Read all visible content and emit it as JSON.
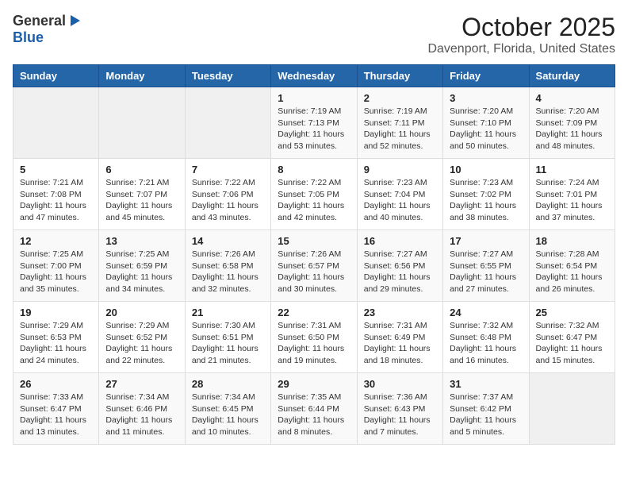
{
  "logo": {
    "general": "General",
    "blue": "Blue"
  },
  "header": {
    "month": "October 2025",
    "location": "Davenport, Florida, United States"
  },
  "weekdays": [
    "Sunday",
    "Monday",
    "Tuesday",
    "Wednesday",
    "Thursday",
    "Friday",
    "Saturday"
  ],
  "weeks": [
    [
      {
        "day": "",
        "info": ""
      },
      {
        "day": "",
        "info": ""
      },
      {
        "day": "",
        "info": ""
      },
      {
        "day": "1",
        "info": "Sunrise: 7:19 AM\nSunset: 7:13 PM\nDaylight: 11 hours\nand 53 minutes."
      },
      {
        "day": "2",
        "info": "Sunrise: 7:19 AM\nSunset: 7:11 PM\nDaylight: 11 hours\nand 52 minutes."
      },
      {
        "day": "3",
        "info": "Sunrise: 7:20 AM\nSunset: 7:10 PM\nDaylight: 11 hours\nand 50 minutes."
      },
      {
        "day": "4",
        "info": "Sunrise: 7:20 AM\nSunset: 7:09 PM\nDaylight: 11 hours\nand 48 minutes."
      }
    ],
    [
      {
        "day": "5",
        "info": "Sunrise: 7:21 AM\nSunset: 7:08 PM\nDaylight: 11 hours\nand 47 minutes."
      },
      {
        "day": "6",
        "info": "Sunrise: 7:21 AM\nSunset: 7:07 PM\nDaylight: 11 hours\nand 45 minutes."
      },
      {
        "day": "7",
        "info": "Sunrise: 7:22 AM\nSunset: 7:06 PM\nDaylight: 11 hours\nand 43 minutes."
      },
      {
        "day": "8",
        "info": "Sunrise: 7:22 AM\nSunset: 7:05 PM\nDaylight: 11 hours\nand 42 minutes."
      },
      {
        "day": "9",
        "info": "Sunrise: 7:23 AM\nSunset: 7:04 PM\nDaylight: 11 hours\nand 40 minutes."
      },
      {
        "day": "10",
        "info": "Sunrise: 7:23 AM\nSunset: 7:02 PM\nDaylight: 11 hours\nand 38 minutes."
      },
      {
        "day": "11",
        "info": "Sunrise: 7:24 AM\nSunset: 7:01 PM\nDaylight: 11 hours\nand 37 minutes."
      }
    ],
    [
      {
        "day": "12",
        "info": "Sunrise: 7:25 AM\nSunset: 7:00 PM\nDaylight: 11 hours\nand 35 minutes."
      },
      {
        "day": "13",
        "info": "Sunrise: 7:25 AM\nSunset: 6:59 PM\nDaylight: 11 hours\nand 34 minutes."
      },
      {
        "day": "14",
        "info": "Sunrise: 7:26 AM\nSunset: 6:58 PM\nDaylight: 11 hours\nand 32 minutes."
      },
      {
        "day": "15",
        "info": "Sunrise: 7:26 AM\nSunset: 6:57 PM\nDaylight: 11 hours\nand 30 minutes."
      },
      {
        "day": "16",
        "info": "Sunrise: 7:27 AM\nSunset: 6:56 PM\nDaylight: 11 hours\nand 29 minutes."
      },
      {
        "day": "17",
        "info": "Sunrise: 7:27 AM\nSunset: 6:55 PM\nDaylight: 11 hours\nand 27 minutes."
      },
      {
        "day": "18",
        "info": "Sunrise: 7:28 AM\nSunset: 6:54 PM\nDaylight: 11 hours\nand 26 minutes."
      }
    ],
    [
      {
        "day": "19",
        "info": "Sunrise: 7:29 AM\nSunset: 6:53 PM\nDaylight: 11 hours\nand 24 minutes."
      },
      {
        "day": "20",
        "info": "Sunrise: 7:29 AM\nSunset: 6:52 PM\nDaylight: 11 hours\nand 22 minutes."
      },
      {
        "day": "21",
        "info": "Sunrise: 7:30 AM\nSunset: 6:51 PM\nDaylight: 11 hours\nand 21 minutes."
      },
      {
        "day": "22",
        "info": "Sunrise: 7:31 AM\nSunset: 6:50 PM\nDaylight: 11 hours\nand 19 minutes."
      },
      {
        "day": "23",
        "info": "Sunrise: 7:31 AM\nSunset: 6:49 PM\nDaylight: 11 hours\nand 18 minutes."
      },
      {
        "day": "24",
        "info": "Sunrise: 7:32 AM\nSunset: 6:48 PM\nDaylight: 11 hours\nand 16 minutes."
      },
      {
        "day": "25",
        "info": "Sunrise: 7:32 AM\nSunset: 6:47 PM\nDaylight: 11 hours\nand 15 minutes."
      }
    ],
    [
      {
        "day": "26",
        "info": "Sunrise: 7:33 AM\nSunset: 6:47 PM\nDaylight: 11 hours\nand 13 minutes."
      },
      {
        "day": "27",
        "info": "Sunrise: 7:34 AM\nSunset: 6:46 PM\nDaylight: 11 hours\nand 11 minutes."
      },
      {
        "day": "28",
        "info": "Sunrise: 7:34 AM\nSunset: 6:45 PM\nDaylight: 11 hours\nand 10 minutes."
      },
      {
        "day": "29",
        "info": "Sunrise: 7:35 AM\nSunset: 6:44 PM\nDaylight: 11 hours\nand 8 minutes."
      },
      {
        "day": "30",
        "info": "Sunrise: 7:36 AM\nSunset: 6:43 PM\nDaylight: 11 hours\nand 7 minutes."
      },
      {
        "day": "31",
        "info": "Sunrise: 7:37 AM\nSunset: 6:42 PM\nDaylight: 11 hours\nand 5 minutes."
      },
      {
        "day": "",
        "info": ""
      }
    ]
  ]
}
